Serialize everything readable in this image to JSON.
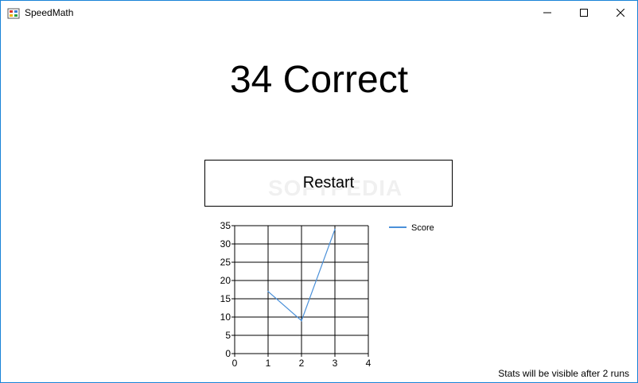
{
  "window": {
    "title": "SpeedMath",
    "controls": [
      "minimize",
      "maximize",
      "close"
    ]
  },
  "result": {
    "text": "34 Correct"
  },
  "restart": {
    "label": "Restart"
  },
  "watermark": "SOFTPEDIA",
  "chart_data": {
    "type": "line",
    "x": [
      1,
      2,
      3
    ],
    "series": [
      {
        "name": "Score",
        "values": [
          17,
          9,
          34
        ],
        "color": "#4a90d9"
      }
    ],
    "xlim": [
      0,
      4
    ],
    "ylim": [
      0,
      35
    ],
    "xticks": [
      "0",
      "1",
      "2",
      "3",
      "4"
    ],
    "yticks": [
      "0",
      "5",
      "10",
      "15",
      "20",
      "25",
      "30",
      "35"
    ],
    "grid": true,
    "legend": "right"
  },
  "footer": {
    "note": "Stats will be visible after 2 runs"
  }
}
